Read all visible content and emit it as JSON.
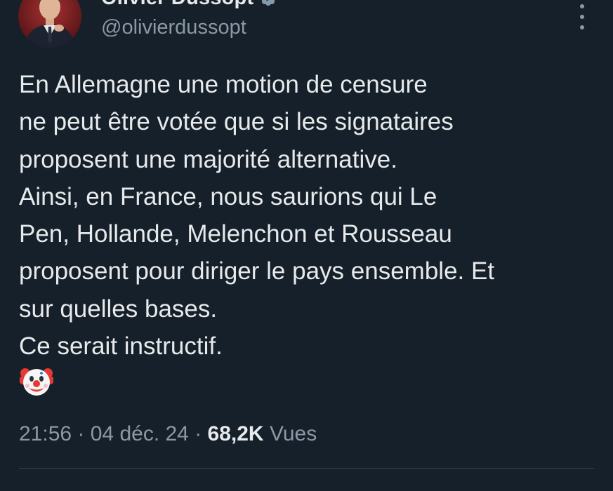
{
  "author": {
    "display_name": "Olivier Dussopt",
    "handle": "@olivierdussopt",
    "verified": true,
    "avatar_icon": "profile-photo"
  },
  "tweet": {
    "lines": [
      "En Allemagne une motion de censure",
      "ne peut être votée que si les signataires",
      "proposent une majorité alternative.",
      "Ainsi, en France, nous saurions qui Le",
      "Pen, Hollande, Melenchon et Rousseau",
      "proposent pour diriger le pays ensemble. Et",
      "sur quelles bases.",
      "Ce serait instructif."
    ],
    "emoji": "clown-face-emoji"
  },
  "meta": {
    "time": "21:56",
    "separator1": " · ",
    "date": "04 déc. 24",
    "separator2": " · ",
    "views_count": "68,2K",
    "views_label": " Vues"
  },
  "colors": {
    "background": "#15202b",
    "text": "#e7e9ea",
    "secondary": "#8b98a5",
    "verified_badge": "#829aab",
    "divider": "#38444d"
  }
}
